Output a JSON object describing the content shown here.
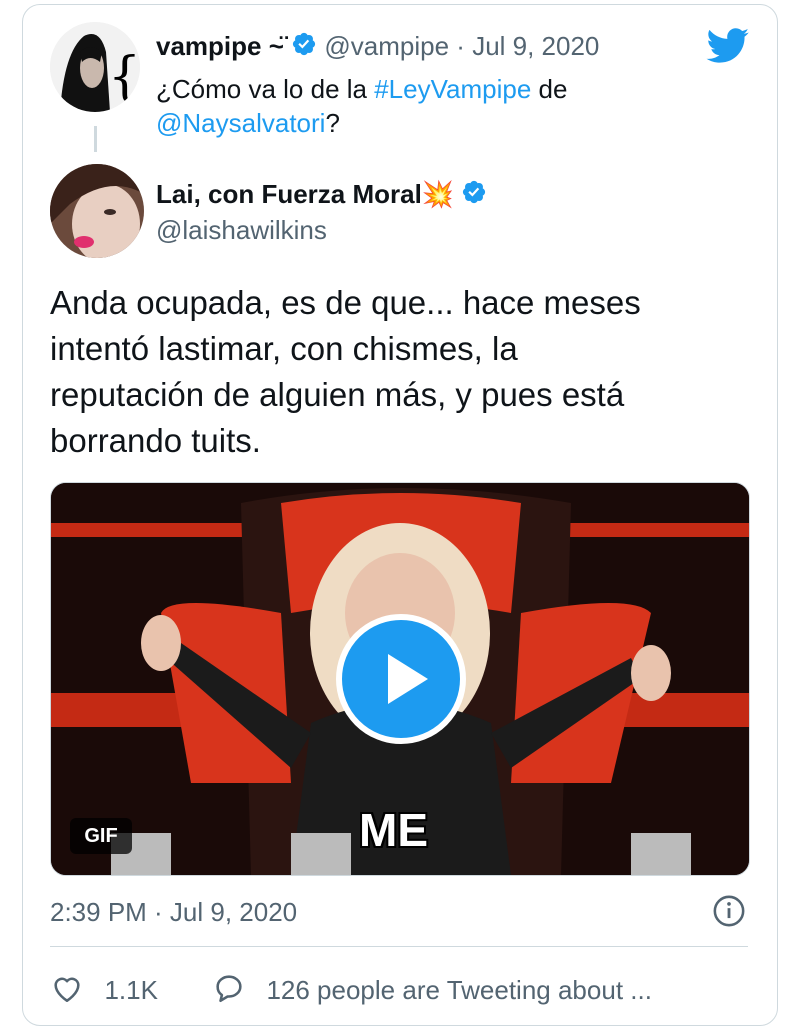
{
  "parent_tweet": {
    "display_name": "vampipe ~̈",
    "handle": "@vampipe",
    "separator": "·",
    "date": "Jul 9, 2020",
    "text_before": "¿Cómo va lo de la ",
    "hashtag": "#LeyVampipe",
    "text_middle": " de",
    "mention": "@Naysalvatori",
    "text_after": "?"
  },
  "reply_tweet": {
    "display_name": "Lai, con Fuerza Moral💥",
    "handle": "@laishawilkins",
    "body_lines": [
      "Anda ocupada, es de que... hace meses",
      "intentó lastimar, con chismes, la",
      "reputación de alguien más, y pues está",
      "borrando tuits."
    ],
    "media": {
      "badge": "GIF",
      "overlay_text": "ME",
      "play_icon": "play-icon"
    },
    "timestamp": "2:39 PM · Jul 9, 2020",
    "likes": "1.1K",
    "conversation": "126 people are Tweeting about ..."
  },
  "icons": {
    "brand": "twitter-bird-icon",
    "verified": "verified-badge-icon",
    "info": "info-icon",
    "like": "heart-icon",
    "reply": "speech-bubble-icon"
  },
  "colors": {
    "accent": "#1d9bf0",
    "text": "#0f1419",
    "secondary": "#536471",
    "border": "#cfd9de"
  }
}
